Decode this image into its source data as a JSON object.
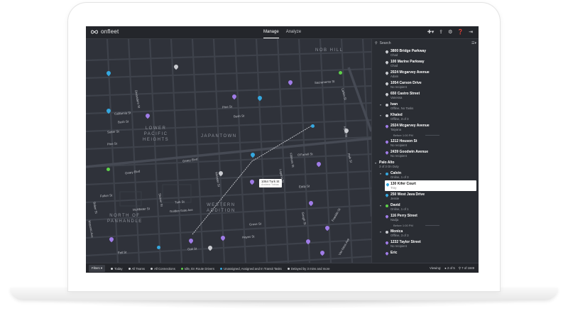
{
  "app": {
    "logo_text": "onfleet",
    "tabs": [
      {
        "label": "Manage",
        "active": true
      },
      {
        "label": "Analyze",
        "active": false
      }
    ],
    "top_icons": [
      "plus-icon",
      "export-icon",
      "gear-icon",
      "help-icon",
      "logout-icon"
    ]
  },
  "map": {
    "areas": [
      {
        "label": "NOB HILL"
      },
      {
        "label": "LOWER\nPACIFIC\nHEIGHTS"
      },
      {
        "label": "JAPANTOWN"
      },
      {
        "label": "WESTERN\nADDITION"
      },
      {
        "label": "NORTH OF\nPANHANDLE"
      }
    ],
    "streets": [
      "California St",
      "Pine St",
      "Bush St",
      "Sutter St",
      "Geary Blvd",
      "Geary Blvd",
      "Turk St",
      "Golden Gate Ave",
      "McAllister St",
      "Fulton St",
      "Grove St",
      "Hayes St",
      "Fell St",
      "Oak St",
      "Franklin St",
      "Gough St",
      "Laguna St",
      "Webster St",
      "Fillmore St",
      "Steiner St",
      "Divisadero St",
      "Baker St",
      "Masonic Ave",
      "Van Ness Ave",
      "Polk St",
      "Larkin St",
      "Hyde St",
      "Sacramento St",
      "O'Farrell St",
      "Eddy St",
      "Pine St",
      "Bush St"
    ],
    "tooltip": {
      "title": "1064 Turk St",
      "subtitle": "Andrew Tobias"
    }
  },
  "sidebar": {
    "search_placeholder": "Search",
    "rows": [
      {
        "kind": "task",
        "title": "3800 Bridge Parkway",
        "sub": "Chad",
        "pin": "grey"
      },
      {
        "kind": "task",
        "title": "100 Marine Parkway",
        "sub": "Chad",
        "pin": "grey"
      },
      {
        "kind": "task",
        "title": "2024 Mcgarvey Avenue",
        "sub": "Adam",
        "pin": "grey"
      },
      {
        "kind": "task",
        "title": "1054 Carson Drive",
        "sub": "No recipient",
        "pin": "grey"
      },
      {
        "kind": "task",
        "title": "650 Castro Street",
        "sub": "Vanessa",
        "pin": "grey"
      },
      {
        "kind": "driver",
        "title": "Ivan",
        "sub": "Offline, No Tasks",
        "avatar": "grey"
      },
      {
        "kind": "driver",
        "title": "Khaled",
        "sub": "Offline, 3 of 3",
        "avatar": "grey"
      },
      {
        "kind": "task",
        "title": "2024 Mcgarvey Avenue",
        "sub": "Tatyana",
        "pin": "purple"
      },
      {
        "kind": "before",
        "label": "Before 1:00 PM"
      },
      {
        "kind": "task",
        "title": "1212 Houson St",
        "sub": "No recipient",
        "pin": "purple"
      },
      {
        "kind": "task",
        "title": "2439 Goodwin Avenue",
        "sub": "No recipient",
        "pin": "purple"
      },
      {
        "kind": "team",
        "title": "Palo Alto",
        "sub": "3 of 3 On Duty"
      },
      {
        "kind": "driver",
        "title": "Calvin",
        "sub": "Online, 1 of 3",
        "avatar": "blue"
      },
      {
        "kind": "highlight",
        "title": "130 Kifer Court",
        "sub": "Troy",
        "pin": "blue"
      },
      {
        "kind": "task",
        "title": "250 West Java Drive",
        "sub": "Jessie",
        "pin": "blue"
      },
      {
        "kind": "driver",
        "title": "David",
        "sub": "Online, 1 of 1",
        "avatar": "green"
      },
      {
        "kind": "task",
        "title": "116 Perry Street",
        "sub": "Nadja",
        "pin": "purple"
      },
      {
        "kind": "before",
        "label": "Before 1:00 PM"
      },
      {
        "kind": "driver",
        "title": "Monica",
        "sub": "Offline, 3 of 3",
        "avatar": "grey"
      },
      {
        "kind": "task",
        "title": "1232 Taylor Street",
        "sub": "No recipient",
        "pin": "purple"
      },
      {
        "kind": "task",
        "title": "Eric",
        "sub": "",
        "pin": "purple"
      }
    ]
  },
  "bottombar": {
    "filters_label": "Filters",
    "items": [
      {
        "label": "Today",
        "icon": "clock-icon"
      },
      {
        "label": "All Teams",
        "icon": "team-icon"
      },
      {
        "label": "All Connections",
        "icon": "link-icon"
      },
      {
        "label": "Idle, En Route Drivers",
        "icon": "driver-icon"
      },
      {
        "label": "Unassigned, Assigned and In Transit Tasks",
        "icon": "task-icon"
      },
      {
        "label": "Delayed by 3 mins and more",
        "icon": "delay-icon"
      }
    ],
    "viewing_label": "Viewing:",
    "viewing_drivers": "2 of 5",
    "viewing_tasks": "7 of 1849"
  },
  "colors": {
    "map_bg": "#2f323a",
    "road": "#3c4049",
    "purple_pin": "#a07ce8",
    "blue_pin": "#35a8e0",
    "green_dot": "#5fd24a"
  }
}
